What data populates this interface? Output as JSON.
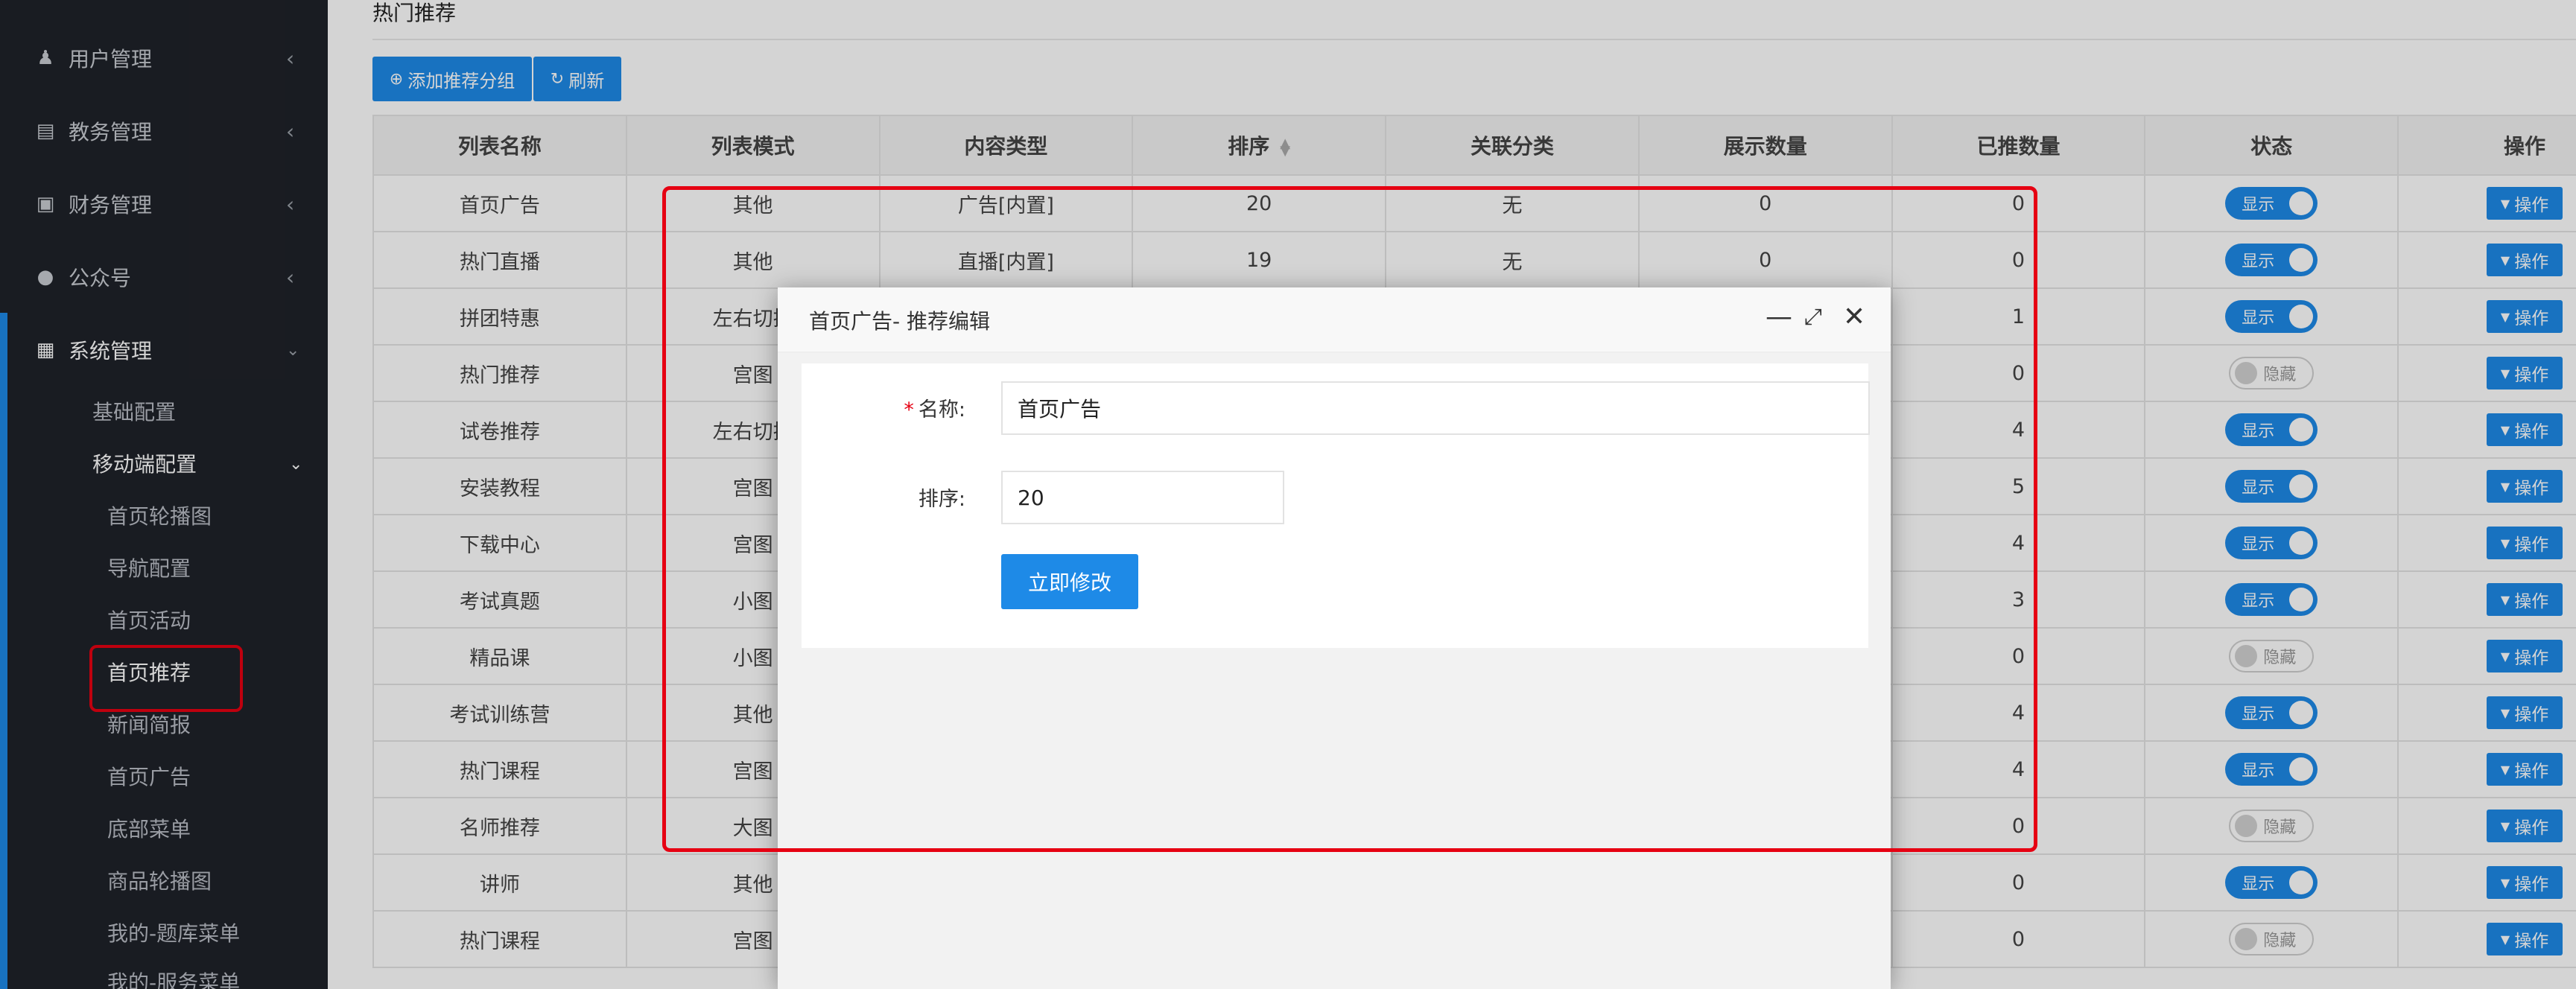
{
  "sidebar": {
    "menus": [
      {
        "label": "用户管理",
        "icon": "user-icon"
      },
      {
        "label": "教务管理",
        "icon": "book-icon"
      },
      {
        "label": "财务管理",
        "icon": "money-icon"
      },
      {
        "label": "公众号",
        "icon": "wechat-icon"
      },
      {
        "label": "系统管理",
        "icon": "grid-icon"
      }
    ],
    "system_children": {
      "basic": "基础配置",
      "mobile": "移动端配置"
    },
    "mobile_children": [
      "首页轮播图",
      "导航配置",
      "首页活动",
      "首页推荐",
      "新闻简报",
      "首页广告",
      "底部菜单",
      "商品轮播图",
      "我的-题库菜单",
      "我的-服务菜单"
    ]
  },
  "page": {
    "title": "热门推荐",
    "add_button": "添加推荐分组",
    "refresh_button": "刷新"
  },
  "table": {
    "headers": [
      "列表名称",
      "列表模式",
      "内容类型",
      "排序",
      "关联分类",
      "展示数量",
      "已推数量",
      "状态",
      "操作"
    ],
    "rows": [
      {
        "name": "首页广告",
        "mode": "其他",
        "type": "广告[内置]",
        "sort": "20",
        "cat": "无",
        "show": "0",
        "pushed": "0",
        "status": "显示",
        "on": true
      },
      {
        "name": "热门直播",
        "mode": "其他",
        "type": "直播[内置]",
        "sort": "19",
        "cat": "无",
        "show": "0",
        "pushed": "0",
        "status": "显示",
        "on": true
      },
      {
        "name": "拼团特惠",
        "mode": "左右切换",
        "type": "",
        "sort": "",
        "cat": "",
        "show": "",
        "pushed": "1",
        "status": "显示",
        "on": true
      },
      {
        "name": "热门推荐",
        "mode": "宫图",
        "type": "",
        "sort": "",
        "cat": "",
        "show": "",
        "pushed": "0",
        "status": "隐藏",
        "on": false
      },
      {
        "name": "试卷推荐",
        "mode": "左右切换",
        "type": "",
        "sort": "",
        "cat": "",
        "show": "",
        "pushed": "4",
        "status": "显示",
        "on": true
      },
      {
        "name": "安装教程",
        "mode": "宫图",
        "type": "",
        "sort": "",
        "cat": "",
        "show": "",
        "pushed": "5",
        "status": "显示",
        "on": true
      },
      {
        "name": "下载中心",
        "mode": "宫图",
        "type": "",
        "sort": "",
        "cat": "",
        "show": "",
        "pushed": "4",
        "status": "显示",
        "on": true
      },
      {
        "name": "考试真题",
        "mode": "小图",
        "type": "",
        "sort": "",
        "cat": "",
        "show": "",
        "pushed": "3",
        "status": "显示",
        "on": true
      },
      {
        "name": "精品课",
        "mode": "小图",
        "type": "",
        "sort": "",
        "cat": "",
        "show": "",
        "pushed": "0",
        "status": "隐藏",
        "on": false
      },
      {
        "name": "考试训练营",
        "mode": "其他",
        "type": "",
        "sort": "",
        "cat": "",
        "show": "",
        "pushed": "4",
        "status": "显示",
        "on": true
      },
      {
        "name": "热门课程",
        "mode": "宫图",
        "type": "",
        "sort": "",
        "cat": "",
        "show": "",
        "pushed": "4",
        "status": "显示",
        "on": true
      },
      {
        "name": "名师推荐",
        "mode": "大图",
        "type": "",
        "sort": "",
        "cat": "",
        "show": "",
        "pushed": "0",
        "status": "隐藏",
        "on": false
      },
      {
        "name": "讲师",
        "mode": "其他",
        "type": "",
        "sort": "",
        "cat": "",
        "show": "",
        "pushed": "0",
        "status": "显示",
        "on": true
      },
      {
        "name": "热门课程",
        "mode": "宫图",
        "type": "",
        "sort": "",
        "cat": "",
        "show": "",
        "pushed": "0",
        "status": "隐藏",
        "on": false
      }
    ],
    "action_label": "操作"
  },
  "dialog": {
    "title": "首页广告- 推荐编辑",
    "name_label": "名称:",
    "name_value": "首页广告",
    "sort_label": "排序:",
    "sort_value": "20",
    "submit": "立即修改"
  }
}
